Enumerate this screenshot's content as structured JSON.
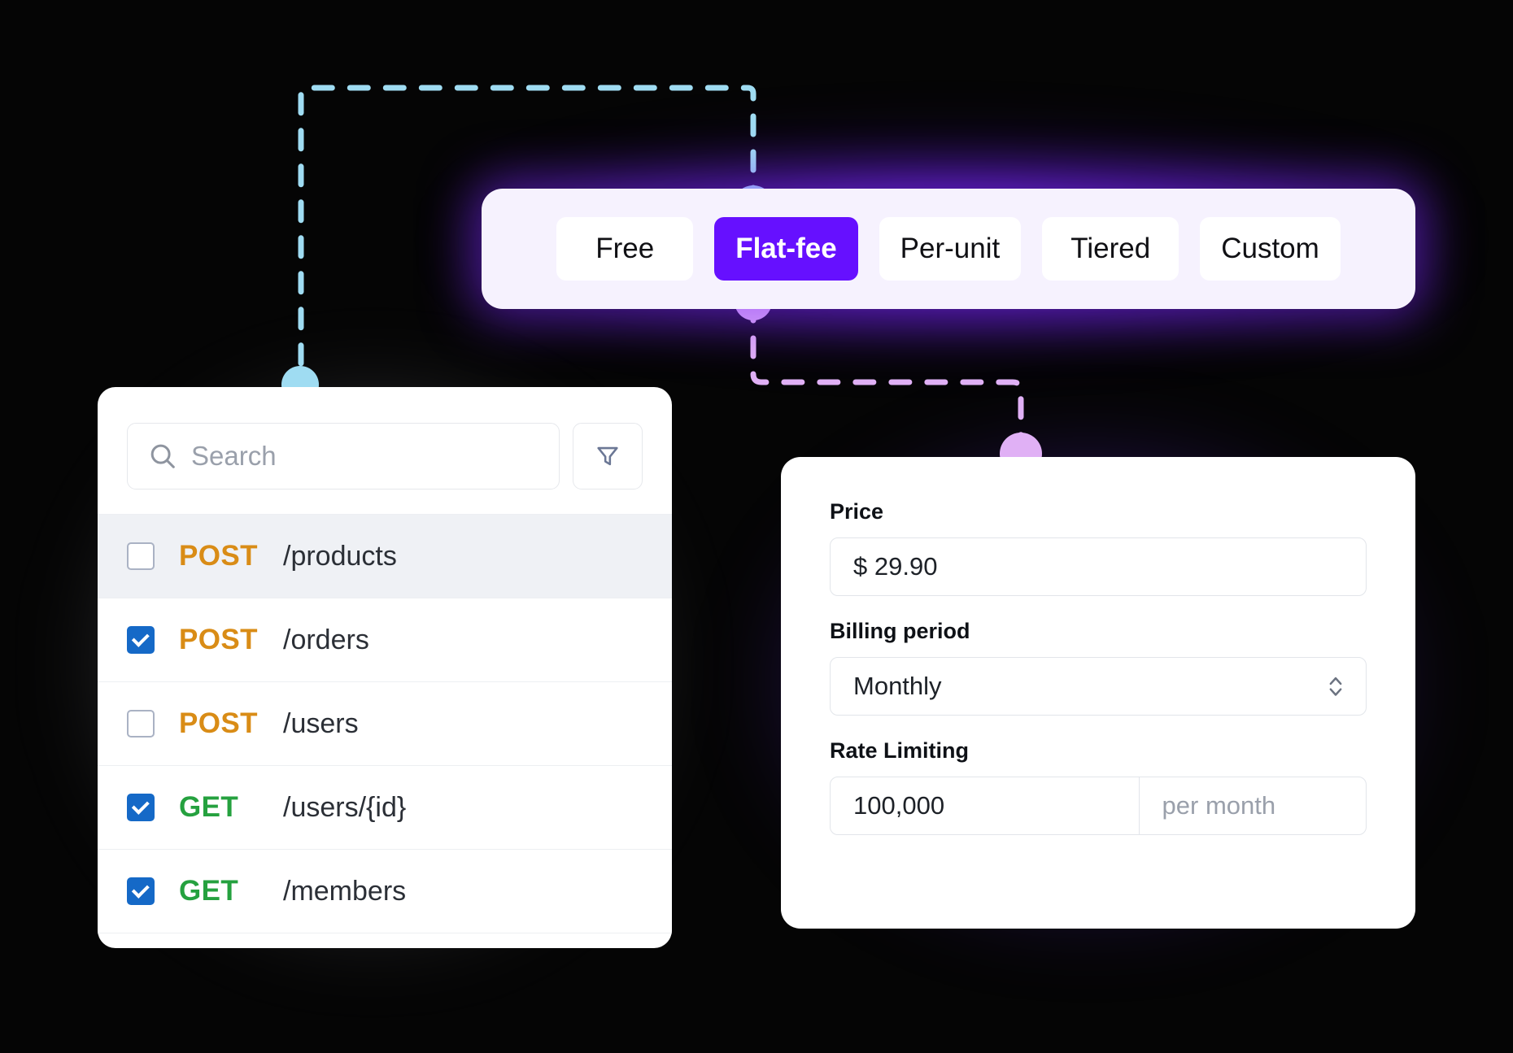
{
  "pricing_tabs": {
    "options": [
      {
        "label": "Free",
        "active": false
      },
      {
        "label": "Flat-fee",
        "active": true
      },
      {
        "label": "Per-unit",
        "active": false
      },
      {
        "label": "Tiered",
        "active": false
      },
      {
        "label": "Custom",
        "active": false
      }
    ],
    "active_color": "#6610ff"
  },
  "endpoints_panel": {
    "search": {
      "placeholder": "Search",
      "value": "",
      "icon": "search-icon"
    },
    "filter_button": {
      "icon": "filter-icon"
    },
    "rows": [
      {
        "checked": false,
        "method": "POST",
        "path": "/products",
        "highlight": true
      },
      {
        "checked": true,
        "method": "POST",
        "path": "/orders",
        "highlight": false
      },
      {
        "checked": false,
        "method": "POST",
        "path": "/users",
        "highlight": false
      },
      {
        "checked": true,
        "method": "GET",
        "path": "/users/{id}",
        "highlight": false
      },
      {
        "checked": true,
        "method": "GET",
        "path": "/members",
        "highlight": false
      }
    ],
    "method_colors": {
      "POST": "#d98c16",
      "GET": "#25a13f"
    },
    "checkbox_color": "#1569c7"
  },
  "pricing_form": {
    "price": {
      "label": "Price",
      "value": "$ 29.90"
    },
    "billing_period": {
      "label": "Billing period",
      "value": "Monthly",
      "icon": "chevron-updown-icon"
    },
    "rate_limiting": {
      "label": "Rate Limiting",
      "amount": "100,000",
      "unit": "per month"
    }
  },
  "connectors": {
    "cyan": {
      "color": "#9fdcf2",
      "from": "flat-fee-tab",
      "to": "endpoints-panel"
    },
    "pink": {
      "color": "#e0b0f5",
      "from": "flat-fee-tab",
      "to": "pricing-form"
    }
  }
}
